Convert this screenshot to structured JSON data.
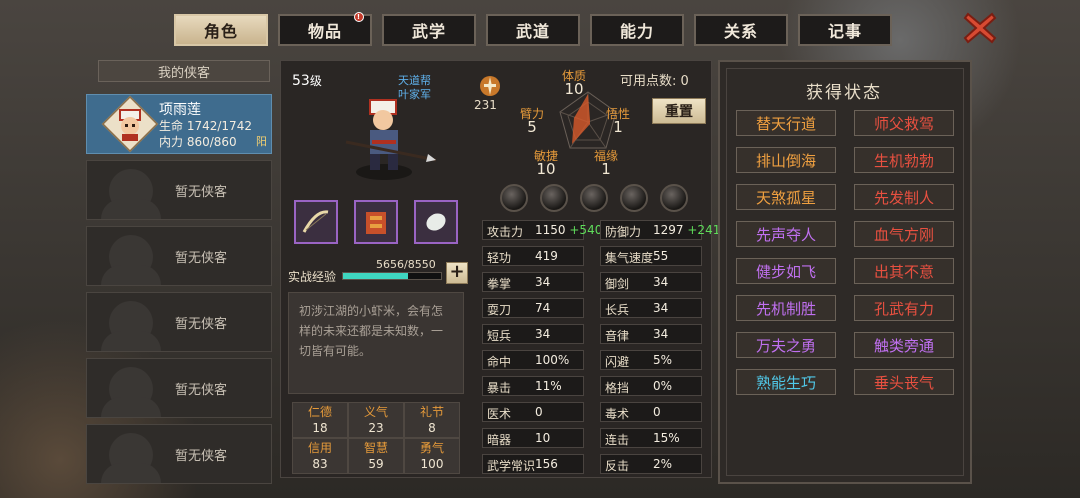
{
  "tabs": [
    {
      "label": "角色",
      "active": true
    },
    {
      "label": "物品",
      "badge": "!"
    },
    {
      "label": "武学"
    },
    {
      "label": "武道"
    },
    {
      "label": "能力"
    },
    {
      "label": "关系"
    },
    {
      "label": "记事"
    }
  ],
  "heroes": {
    "title": "我的侠客",
    "selected": {
      "name": "项雨莲",
      "hp_label": "生命",
      "hp": "1742/1742",
      "mp_label": "内力",
      "mp": "860/860",
      "tag": "阳"
    },
    "empty_label": "暂无侠客"
  },
  "character": {
    "level": "53",
    "level_suffix": "级",
    "sect": "天道帮",
    "faction": "叶家军",
    "power": "231",
    "points_label": "可用点数: 0",
    "reset_label": "重置",
    "exp_label": "实战经验",
    "exp_value": "5656/8550",
    "exp_ratio": 0.66,
    "exp_plus": "+",
    "description": "初涉江湖的小虾米，会有怎样的未来还都是未知数，一切皆有可能。"
  },
  "radar": {
    "tizhi": {
      "label": "体质",
      "value": "10"
    },
    "wuxing": {
      "label": "悟性",
      "value": "1"
    },
    "fuyuan": {
      "label": "福缘",
      "value": "1"
    },
    "minjie": {
      "label": "敏捷",
      "value": "10"
    },
    "bili": {
      "label": "臂力",
      "value": "5"
    }
  },
  "virtues": [
    {
      "label": "仁德",
      "value": "18"
    },
    {
      "label": "义气",
      "value": "23"
    },
    {
      "label": "礼节",
      "value": "8"
    },
    {
      "label": "信用",
      "value": "83"
    },
    {
      "label": "智慧",
      "value": "59"
    },
    {
      "label": "勇气",
      "value": "100"
    }
  ],
  "stats_left": [
    {
      "k": "攻击力",
      "v": "1150",
      "b": "+540"
    },
    {
      "k": "轻功",
      "v": "419"
    },
    {
      "k": "拳掌",
      "v": "34"
    },
    {
      "k": "耍刀",
      "v": "74"
    },
    {
      "k": "短兵",
      "v": "34"
    },
    {
      "k": "命中",
      "v": "100%"
    },
    {
      "k": "暴击",
      "v": "11%"
    },
    {
      "k": "医术",
      "v": "0"
    },
    {
      "k": "暗器",
      "v": "10"
    },
    {
      "k": "武学常识",
      "v": "156"
    }
  ],
  "stats_right": [
    {
      "k": "防御力",
      "v": "1297",
      "b": "+241"
    },
    {
      "k": "集气速度",
      "v": "55"
    },
    {
      "k": "御剑",
      "v": "34"
    },
    {
      "k": "长兵",
      "v": "34"
    },
    {
      "k": "音律",
      "v": "34"
    },
    {
      "k": "闪避",
      "v": "5%"
    },
    {
      "k": "格挡",
      "v": "0%"
    },
    {
      "k": "毒术",
      "v": "0"
    },
    {
      "k": "连击",
      "v": "15%"
    },
    {
      "k": "反击",
      "v": "2%"
    }
  ],
  "status_panel": {
    "title": "获得状态",
    "items": [
      {
        "label": "替天行道",
        "color": "#f0a040"
      },
      {
        "label": "师父救驾",
        "color": "#e85040"
      },
      {
        "label": "排山倒海",
        "color": "#f0a040"
      },
      {
        "label": "生机勃勃",
        "color": "#e85040"
      },
      {
        "label": "天煞孤星",
        "color": "#f0a040"
      },
      {
        "label": "先发制人",
        "color": "#e85040"
      },
      {
        "label": "先声夺人",
        "color": "#c070f0"
      },
      {
        "label": "血气方刚",
        "color": "#e85040"
      },
      {
        "label": "健步如飞",
        "color": "#c070f0"
      },
      {
        "label": "出其不意",
        "color": "#e85040"
      },
      {
        "label": "先机制胜",
        "color": "#c070f0"
      },
      {
        "label": "孔武有力",
        "color": "#e85040"
      },
      {
        "label": "万夫之勇",
        "color": "#c070f0"
      },
      {
        "label": "触类旁通",
        "color": "#c070f0"
      },
      {
        "label": "熟能生巧",
        "color": "#50c8e8"
      },
      {
        "label": "垂头丧气",
        "color": "#e85040"
      }
    ]
  }
}
